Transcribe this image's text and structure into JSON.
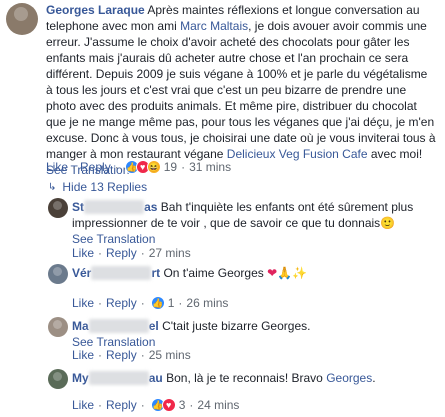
{
  "main_comment": {
    "author": "Georges Laraque",
    "text_part1": "Après maintes réflexions et longue conversation au telephone avec mon ami ",
    "mention": "Marc Maltais",
    "text_part2": ", je dois avouer avoir commis une erreur. J'assume le choix d'avoir acheté des chocolats pour gâter les enfants mais j'aurais dû acheter autre chose et l'an prochain ce sera différent. Depuis 2009 je suis végane à 100% et je parle du végétalisme à tous les jours et c'est vrai que c'est un peu bizarre de prendre une photo avec des produits animals. Et même pire, distribuer du chocolat que je ne mange même pas, pour tous les véganes que j'ai déçu, je m'en excuse. Donc à vous tous, je choisirai une date où je vous inviterai tous à manger à mon restaurant végane ",
    "link": "Delicieux Veg Fusion Cafe",
    "text_part3": " avec moi!",
    "see_translation": "See Translation",
    "like": "Like",
    "reply": "Reply",
    "reaction_count": "19",
    "time": "31 mins"
  },
  "hide_replies": {
    "arrow": "↳",
    "label": "Hide 13 Replies"
  },
  "replies": [
    {
      "author_start": "St",
      "author_end": "as",
      "text": " Bah t'inquiète les enfants ont été sûrement plus impressionner de te voir , que de savoir ce que tu donnais",
      "emoji": "🙂",
      "see_translation": "See Translation",
      "like": "Like",
      "reply": "Reply",
      "time": "27 mins"
    },
    {
      "author_start": "Vér",
      "author_end": "rt",
      "text": " On t'aime Georges ",
      "emoji": "❤🙏✨",
      "like": "Like",
      "reply": "Reply",
      "reaction_count": "1",
      "time": "26 mins"
    },
    {
      "author_start": "Ma",
      "author_end": "el",
      "text": " C'tait juste bizarre Georges.",
      "see_translation": "See Translation",
      "like": "Like",
      "reply": "Reply",
      "time": "25 mins"
    },
    {
      "author_start": "My",
      "author_end": "au",
      "text": " Bon, là je te reconnais! Bravo ",
      "mention": "Georges",
      "text_end": ".",
      "like": "Like",
      "reply": "Reply",
      "reaction_count": "3",
      "time": "24 mins"
    }
  ],
  "reaction_icons": [
    "like",
    "love",
    "haha"
  ],
  "colors": {
    "link": "#385898",
    "meta": "#606770",
    "text": "#1d2129"
  }
}
